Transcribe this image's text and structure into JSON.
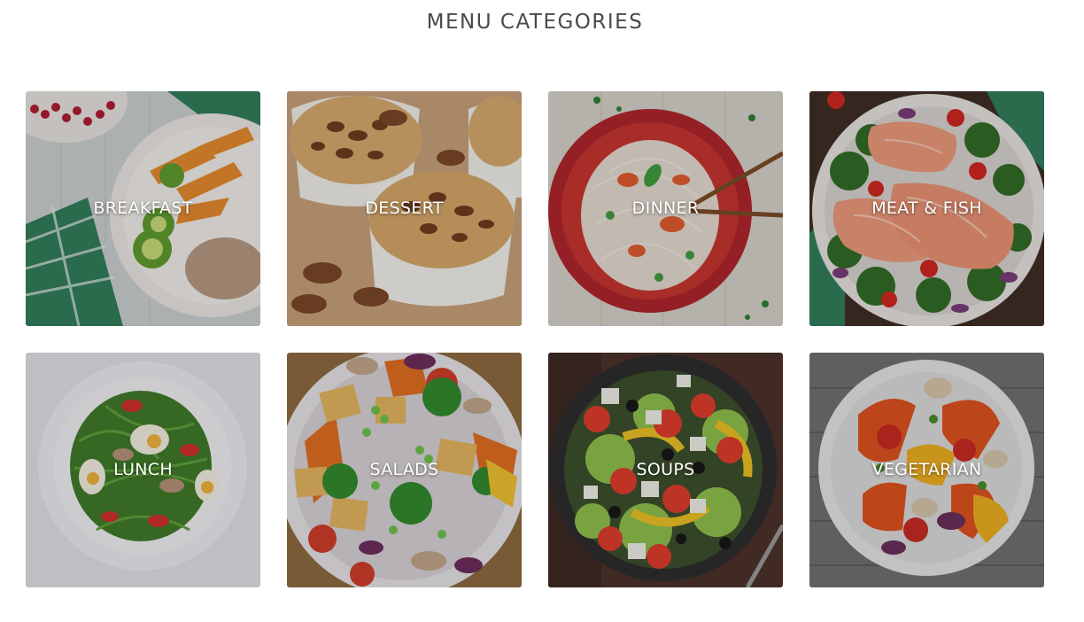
{
  "heading": "MENU CATEGORIES",
  "categories": [
    {
      "label": "BREAKFAST",
      "image": "breakfast-plate-photo"
    },
    {
      "label": "DESSERT",
      "image": "pecan-muffins-photo"
    },
    {
      "label": "DINNER",
      "image": "noodle-bowl-photo"
    },
    {
      "label": "MEAT & FISH",
      "image": "salmon-broccoli-photo"
    },
    {
      "label": "LUNCH",
      "image": "arugula-salad-photo"
    },
    {
      "label": "SALADS",
      "image": "tofu-vegetable-bowl-photo"
    },
    {
      "label": "SOUPS",
      "image": "greek-salad-bowl-photo"
    },
    {
      "label": "VEGETARIAN",
      "image": "roasted-peppers-plate-photo"
    }
  ]
}
